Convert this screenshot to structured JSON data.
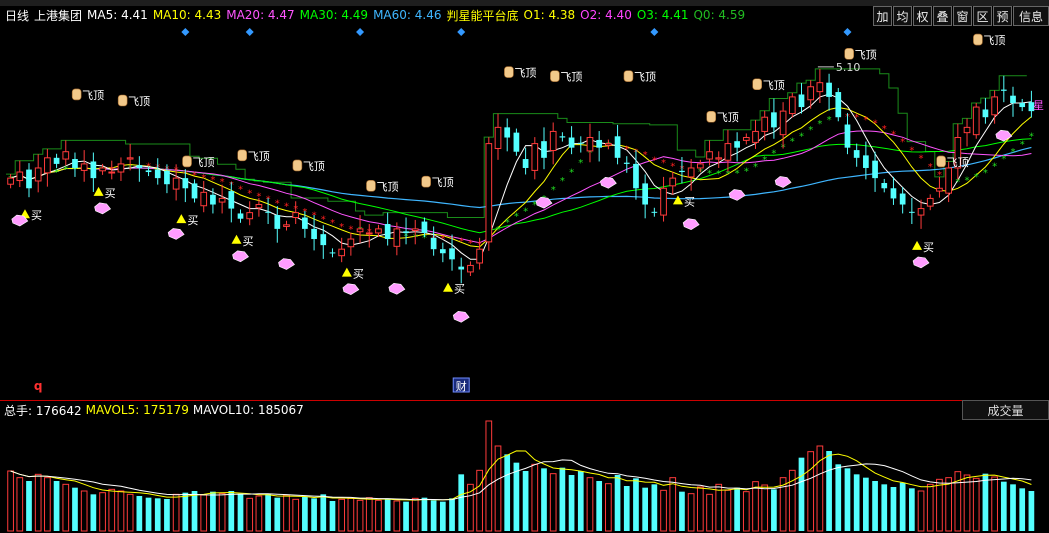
{
  "header": {
    "period": "日线",
    "stock_name": "上港集团",
    "ma5": "MA5: 4.41",
    "ma10": "MA10: 4.43",
    "ma20": "MA20: 4.47",
    "ma30": "MA30: 4.49",
    "ma60": "MA60: 4.46",
    "indicator": "判星能平台底",
    "o1": "O1: 4.38",
    "o2": "O2: 4.40",
    "o3": "O3: 4.41",
    "q0": "Q0: 4.59"
  },
  "toolbar": [
    "加",
    "均",
    "权",
    "叠",
    "窗",
    "区",
    "预",
    "信息"
  ],
  "volume_header": {
    "total": "总手: 176642",
    "mavol5": "MAVOL5: 175179",
    "mavol10": "MAVOL10: 185067",
    "button": "成交量"
  },
  "labels": {
    "buy": "买",
    "fly_top": "飞顶",
    "finance": "财",
    "q_marker": "q",
    "peak_price": "5.10",
    "right_edge_label": "星"
  },
  "colors": {
    "up": "#ff3b3b",
    "down": "#54ffff",
    "ma5": "#ffffff",
    "ma10": "#ffff00",
    "ma20": "#ff55ff",
    "ma30": "#00ff00",
    "ma60": "#3fb6ff",
    "star_red": "#ff2020",
    "star_green": "#22dd22",
    "step_line": "#1a8c1a",
    "buy": "#ffff00",
    "diamond": "#ff9cff",
    "marker_blue": "#3399ff"
  },
  "chart_data": {
    "type": "candlestick",
    "title": "上港集团 日线",
    "num_candles": 112,
    "price_ylim": [
      3.6,
      5.25
    ],
    "volume_ylim": [
      0,
      330000
    ],
    "blue_markers_at": [
      19,
      26,
      38,
      49,
      70,
      91
    ],
    "buy_signals": [
      2,
      10,
      19,
      25,
      37,
      48,
      73,
      99
    ],
    "fly_top_signals": [
      {
        "index": 8,
        "price": 4.95
      },
      {
        "index": 13,
        "price": 4.92
      },
      {
        "index": 20,
        "price": 4.62
      },
      {
        "index": 26,
        "price": 4.65
      },
      {
        "index": 32,
        "price": 4.6
      },
      {
        "index": 40,
        "price": 4.5
      },
      {
        "index": 46,
        "price": 4.52
      },
      {
        "index": 55,
        "price": 5.06
      },
      {
        "index": 60,
        "price": 5.04
      },
      {
        "index": 68,
        "price": 5.04
      },
      {
        "index": 77,
        "price": 4.84
      },
      {
        "index": 82,
        "price": 5.0
      },
      {
        "index": 92,
        "price": 5.15
      },
      {
        "index": 102,
        "price": 4.62
      },
      {
        "index": 106,
        "price": 5.22
      }
    ],
    "diamond_signals": [
      1,
      10,
      18,
      25,
      30,
      37,
      42,
      49,
      58,
      65,
      74,
      79,
      84,
      99,
      108
    ],
    "finance_marker_index": 49,
    "q_marker_index": 3,
    "series": [
      {
        "name": "MA5",
        "value": 4.41
      },
      {
        "name": "MA10",
        "value": 4.43
      },
      {
        "name": "MA20",
        "value": 4.47
      },
      {
        "name": "MA30",
        "value": 4.49
      },
      {
        "name": "MA60",
        "value": 4.46
      },
      {
        "name": "MAVOL5",
        "value": 175179
      },
      {
        "name": "MAVOL10",
        "value": 185067
      }
    ],
    "closes": [
      4.55,
      4.58,
      4.5,
      4.6,
      4.65,
      4.62,
      4.68,
      4.6,
      4.62,
      4.55,
      4.6,
      4.58,
      4.62,
      4.65,
      4.6,
      4.58,
      4.55,
      4.52,
      4.55,
      4.5,
      4.45,
      4.48,
      4.42,
      4.45,
      4.4,
      4.35,
      4.38,
      4.42,
      4.38,
      4.3,
      4.32,
      4.38,
      4.3,
      4.25,
      4.22,
      4.18,
      4.2,
      4.25,
      4.3,
      4.28,
      4.3,
      4.25,
      4.3,
      4.28,
      4.3,
      4.28,
      4.2,
      4.18,
      4.15,
      4.1,
      4.12,
      4.2,
      4.72,
      4.8,
      4.75,
      4.68,
      4.6,
      4.72,
      4.65,
      4.78,
      4.75,
      4.7,
      4.72,
      4.75,
      4.7,
      4.72,
      4.65,
      4.62,
      4.5,
      4.42,
      4.38,
      4.5,
      4.55,
      4.58,
      4.6,
      4.62,
      4.68,
      4.65,
      4.72,
      4.7,
      4.75,
      4.78,
      4.85,
      4.8,
      4.88,
      4.95,
      4.9,
      5.0,
      5.02,
      4.95,
      4.85,
      4.7,
      4.65,
      4.6,
      4.55,
      4.5,
      4.45,
      4.42,
      4.38,
      4.4,
      4.45,
      4.5,
      4.6,
      4.75,
      4.8,
      4.9,
      4.85,
      4.95,
      4.98,
      4.92,
      4.9,
      4.88
    ],
    "volumes": [
      180000,
      160000,
      150000,
      170000,
      160000,
      150000,
      140000,
      130000,
      120000,
      110000,
      115000,
      125000,
      120000,
      110000,
      105000,
      100000,
      98000,
      96000,
      110000,
      115000,
      120000,
      108000,
      118000,
      112000,
      120000,
      110000,
      98000,
      105000,
      112000,
      100000,
      108000,
      95000,
      102000,
      98000,
      110000,
      90000,
      95000,
      98000,
      92000,
      100000,
      92000,
      96000,
      90000,
      88000,
      98000,
      100000,
      92000,
      88000,
      98000,
      170000,
      140000,
      182000,
      330000,
      255000,
      230000,
      205000,
      180000,
      200000,
      188000,
      172000,
      190000,
      168000,
      180000,
      160000,
      150000,
      142000,
      168000,
      135000,
      158000,
      130000,
      140000,
      122000,
      160000,
      118000,
      112000,
      132000,
      110000,
      140000,
      122000,
      130000,
      118000,
      148000,
      138000,
      125000,
      160000,
      182000,
      220000,
      238000,
      255000,
      240000,
      200000,
      188000,
      170000,
      160000,
      150000,
      140000,
      132000,
      145000,
      128000,
      120000,
      140000,
      155000,
      160000,
      178000,
      168000,
      158000,
      172000,
      162000,
      148000,
      140000,
      128000,
      120000
    ]
  }
}
